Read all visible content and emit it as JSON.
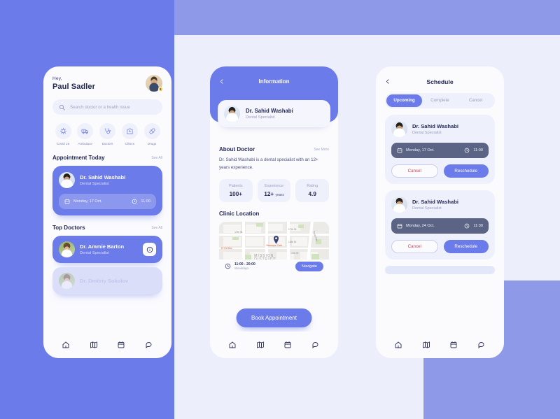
{
  "background": {
    "left_panel_color": "#6c7bea",
    "top_right_color": "#8e99e8",
    "page_color": "#eceefb"
  },
  "screen_home": {
    "greeting": "Hey,",
    "user_name": "Paul Sadler",
    "avatar_badge": "1",
    "search_placeholder": "Search doctor or a health issue",
    "categories": [
      {
        "label": "Covid 19",
        "icon": "virus-icon"
      },
      {
        "label": "Ambulace",
        "icon": "ambulance-icon"
      },
      {
        "label": "Doctors",
        "icon": "stethoscope-icon"
      },
      {
        "label": "Clinics",
        "icon": "hospital-icon"
      },
      {
        "label": "Drugs",
        "icon": "pill-icon"
      }
    ],
    "appointment_section": {
      "title": "Appointment Today",
      "see_all": "See All",
      "doctor_name": "Dr. Sahid Washabi",
      "doctor_specialty": "Dental Specialist",
      "date": "Monday, 17 Oct.",
      "time": "11:00"
    },
    "top_doctors_section": {
      "title": "Top Doctors",
      "see_all": "See All",
      "doctors": [
        {
          "name": "Dr. Ammie Barton",
          "specialty": "Dental Specialist"
        },
        {
          "name": "Dr. Dmitriy Sokolov",
          "specialty": "Dental Specialist"
        }
      ]
    }
  },
  "screen_information": {
    "back_icon": "chevron-left-icon",
    "title": "Information",
    "doctor_name": "Dr. Sahid Washabi",
    "doctor_specialty": "Dental Specialist",
    "about_title": "About Doctor",
    "about_see_more": "See More",
    "about_text": "Dr. Sahid Washabi is a dental specialist with an 12+ years experience.",
    "stats": [
      {
        "key": "Patients",
        "value": "100+",
        "unit": ""
      },
      {
        "key": "Experience",
        "value": "12+",
        "unit": "years"
      },
      {
        "key": "Rating",
        "value": "4.9",
        "unit": ""
      }
    ],
    "clinic_title": "Clinic Location",
    "map_labels": {
      "street_1": "17th St.",
      "street_2": "17th St.",
      "street_3": "18th St",
      "street_4": "19th St",
      "avenue": "Treat Ave",
      "poi_1": "Balampé Cafe",
      "poi_2": "El Delfina",
      "district_line1": "MISSION",
      "district_line2": "DISTRICT"
    },
    "hours_main": "11:00 - 20:00",
    "hours_sub": "Weekdays",
    "navigate_label": "Navigate",
    "book_label": "Book Appointment"
  },
  "screen_schedule": {
    "back_icon": "chevron-left-icon",
    "title": "Schedule",
    "tabs": [
      {
        "label": "Upcoming",
        "active": true
      },
      {
        "label": "Complete",
        "active": false
      },
      {
        "label": "Cancel",
        "active": false
      }
    ],
    "appointments": [
      {
        "doctor_name": "Dr. Sahid Washabi",
        "doctor_specialty": "Dental Specialist",
        "date": "Monday, 17 Oct.",
        "time": "11:00",
        "cancel_label": "Cancel",
        "reschedule_label": "Reschedule"
      },
      {
        "doctor_name": "Dr. Sahid Washabi",
        "doctor_specialty": "Dental Specialist",
        "date": "Monday, 24 Oct.",
        "time": "11:30",
        "cancel_label": "Cancel",
        "reschedule_label": "Reschedule"
      }
    ]
  },
  "bottom_nav": [
    {
      "icon": "home-icon",
      "active": true
    },
    {
      "icon": "map-icon",
      "active": false
    },
    {
      "icon": "calendar-icon",
      "active": false
    },
    {
      "icon": "chat-icon",
      "active": false
    }
  ]
}
